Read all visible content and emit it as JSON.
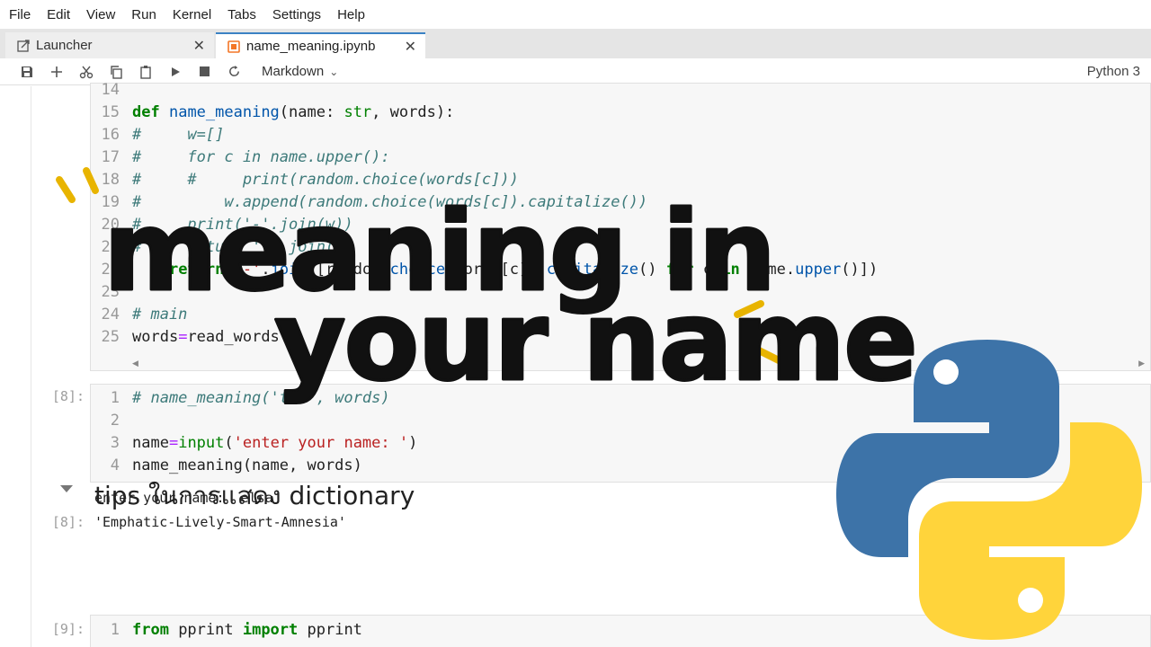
{
  "menu": [
    "File",
    "Edit",
    "View",
    "Run",
    "Kernel",
    "Tabs",
    "Settings",
    "Help"
  ],
  "tabs": [
    {
      "label": "Launcher",
      "icon": "launcher-icon"
    },
    {
      "label": "name_meaning.ipynb",
      "icon": "notebook-icon"
    }
  ],
  "toolbar": {
    "buttons": [
      "save-icon",
      "add-icon",
      "cut-icon",
      "copy-icon",
      "paste-icon",
      "run-icon",
      "stop-icon",
      "restart-icon"
    ],
    "cell_type": "Markdown",
    "kernel": "Python 3"
  },
  "cell1": {
    "lines": [
      {
        "n": "14",
        "text": ""
      },
      {
        "n": "15",
        "text": "def name_meaning(name: str, words):"
      },
      {
        "n": "16",
        "text": "#     w=[]"
      },
      {
        "n": "17",
        "text": "#     for c in name.upper():"
      },
      {
        "n": "18",
        "text": "#     #     print(random.choice(words[c]))"
      },
      {
        "n": "19",
        "text": "#         w.append(random.choice(words[c]).capitalize())"
      },
      {
        "n": "20",
        "text": "#     print('-'.join(w))"
      },
      {
        "n": "21",
        "text": "#     return '-'.join(w)"
      },
      {
        "n": "22",
        "text": "    return '-'.join([random.choice(words[c]).capitalize() for c in name.upper()])"
      },
      {
        "n": "23",
        "text": ""
      },
      {
        "n": "24",
        "text": "# main"
      },
      {
        "n": "25",
        "text": "words=read_words()"
      }
    ]
  },
  "cell2": {
    "prompt": "[8]:",
    "lines": [
      {
        "n": "1",
        "text": "# name_meaning('tom', words)"
      },
      {
        "n": "2",
        "text": ""
      },
      {
        "n": "3",
        "text": "name=input('enter your name: ')"
      },
      {
        "n": "4",
        "text": "name_meaning(name, words)"
      }
    ],
    "stdout": "enter your name:  elsa",
    "out_prompt": "[8]:",
    "result": "'Emphatic-Lively-Smart-Amnesia'"
  },
  "heading": "tips ในการแสดง dictionary",
  "cell3": {
    "prompt": "[9]:",
    "lines": [
      {
        "n": "1",
        "text": "from pprint import pprint"
      }
    ]
  },
  "overlay": {
    "line1": "meaning in",
    "line2": "your name",
    "logo_colors": {
      "blue": "#3d73a8",
      "yellow": "#ffd43b"
    },
    "accent": "#e8b400"
  }
}
